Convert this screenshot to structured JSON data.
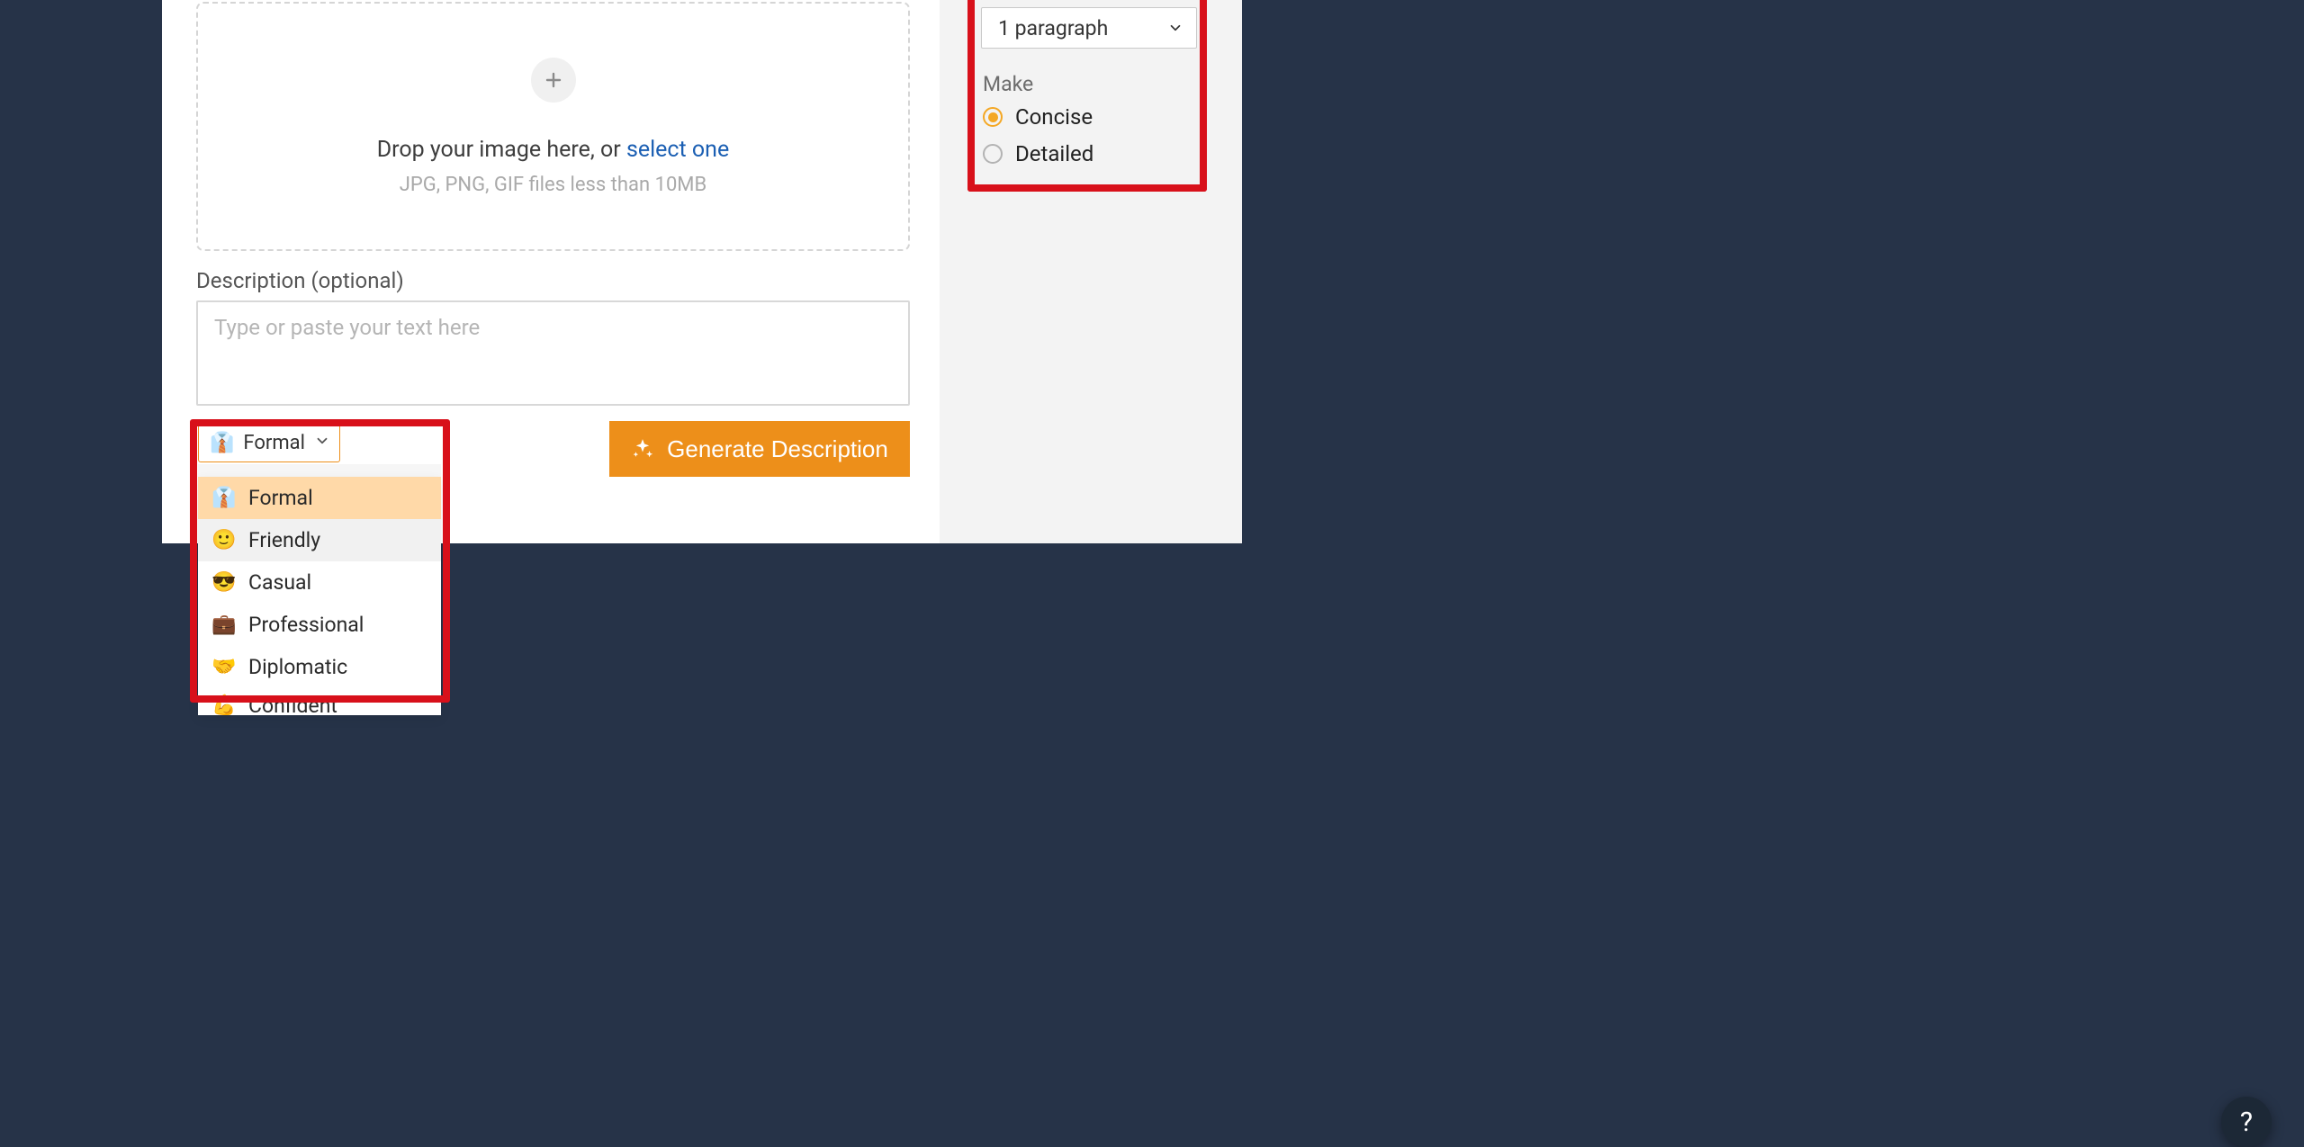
{
  "dropzone": {
    "prompt_prefix": "Drop your image here, or ",
    "select_link": "select one",
    "hint": "JPG, PNG, GIF files less than 10MB"
  },
  "description": {
    "label": "Description (optional)",
    "placeholder": "Type or paste your text here"
  },
  "tone": {
    "selected_label": "Formal",
    "selected_emoji": "👔",
    "options": [
      {
        "emoji": "👔",
        "label": "Formal",
        "state": "selected"
      },
      {
        "emoji": "🙂",
        "label": "Friendly",
        "state": "hover"
      },
      {
        "emoji": "😎",
        "label": "Casual",
        "state": ""
      },
      {
        "emoji": "💼",
        "label": "Professional",
        "state": ""
      },
      {
        "emoji": "🤝",
        "label": "Diplomatic",
        "state": ""
      },
      {
        "emoji": "💪",
        "label": "Confident",
        "state": "cut"
      }
    ]
  },
  "generate_button": "Generate Description",
  "sidebar": {
    "paragraph_selected": "1 paragraph",
    "make_label": "Make",
    "radio_concise": "Concise",
    "radio_detailed": "Detailed",
    "radio_selected": "concise"
  },
  "help_label": "?"
}
